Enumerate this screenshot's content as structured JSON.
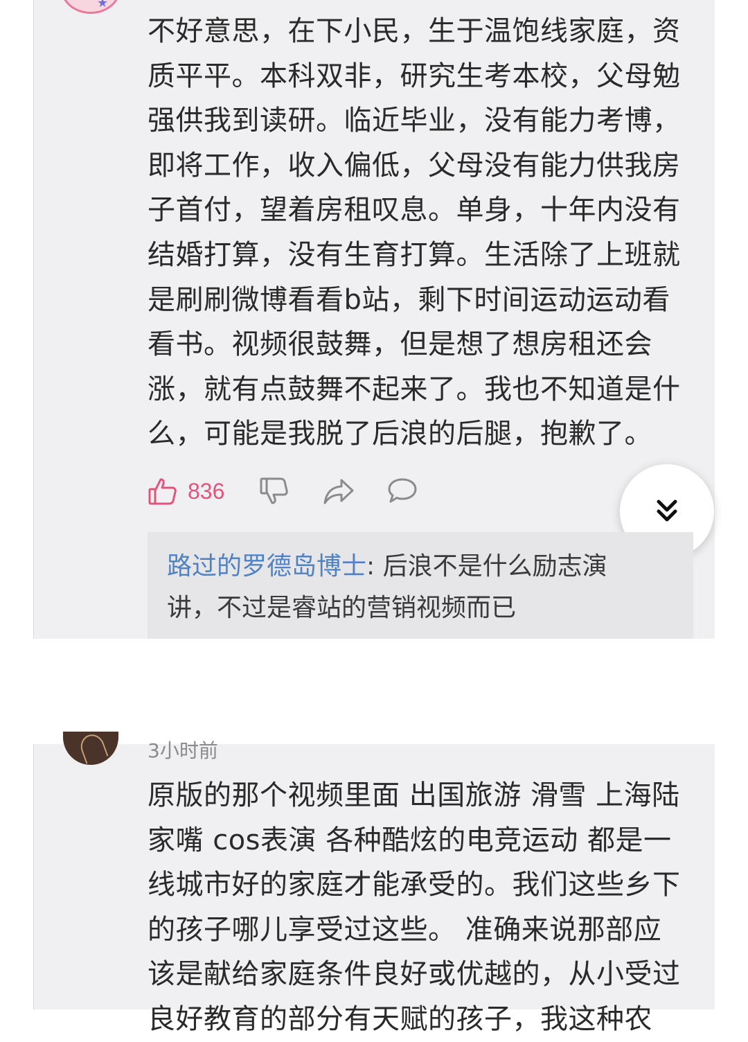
{
  "comment1": {
    "text": "不好意思，在下小民，生于温饱线家庭，资\n质平平。本科双非，研究生考本校，父母勉\n强供我到读研。临近毕业，没有能力考博，\n即将工作，收入偏低，父母没有能力供我房\n子首付，望着房租叹息。单身，十年内没有\n结婚打算，没有生育打算。生活除了上班就\n是刷刷微博看看b站，剩下时间运动运动看\n看书。视频很鼓舞，但是想了想房租还会\n涨，就有点鼓舞不起来了。我也不知道是什\n么，可能是我脱了后浪的后腿，抱歉了。",
    "like_count": "836",
    "reply": {
      "author": "路过的罗德岛博士",
      "separator": ": ",
      "text": "后浪不是什么励志演\n讲，不过是睿站的营销视频而已"
    }
  },
  "comment2": {
    "time": "3小时前",
    "text": "原版的那个视频里面 出国旅游 滑雪 上海陆\n家嘴 cos表演  各种酷炫的电竞运动 都是一\n线城市好的家庭才能承受的。我们这些乡下\n的孩子哪儿享受过这些。 准确来说那部应\n该是献给家庭条件良好或优越的，从小受过\n良好教育的部分有天赋的孩子，我这种农"
  },
  "colors": {
    "like_accent": "#e5537c",
    "reply_author": "#4f82c4",
    "panel_bg": "#f0f0f2",
    "text": "#2a2a2a"
  },
  "icons": [
    "thumbs-up-icon",
    "thumbs-down-icon",
    "share-icon",
    "comment-icon",
    "double-chevron-down-icon"
  ]
}
